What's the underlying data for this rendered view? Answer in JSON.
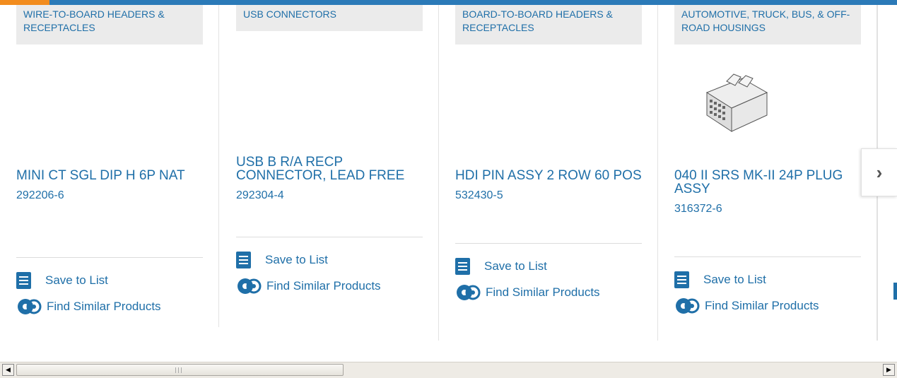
{
  "carousel": {
    "cards": [
      {
        "category": "WIRE-TO-BOARD HEADERS & RECEPTACLES",
        "title": "MINI CT SGL DIP H 6P NAT",
        "part_number": "292206-6",
        "save_label": "Save to List",
        "similar_label": "Find Similar Products"
      },
      {
        "category": "USB CONNECTORS",
        "title": "USB B R/A RECP CONNECTOR, LEAD FREE",
        "part_number": "292304-4",
        "save_label": "Save to List",
        "similar_label": "Find Similar Products"
      },
      {
        "category": "BOARD-TO-BOARD HEADERS & RECEPTACLES",
        "title": "HDI PIN ASSY 2 ROW 60 POS",
        "part_number": "532430-5",
        "save_label": "Save to List",
        "similar_label": "Find Similar Products"
      },
      {
        "category": "AUTOMOTIVE, TRUCK, BUS, & OFF-ROAD HOUSINGS",
        "title": "040 II SRS MK-II 24P PLUG ASSY",
        "part_number": "316372-6",
        "save_label": "Save to List",
        "similar_label": "Find Similar Products"
      }
    ],
    "next_icon": "chevron-right-icon"
  },
  "colors": {
    "link": "#1f6fa8",
    "accent": "#f28c1e",
    "bar": "#2b7ab8"
  }
}
